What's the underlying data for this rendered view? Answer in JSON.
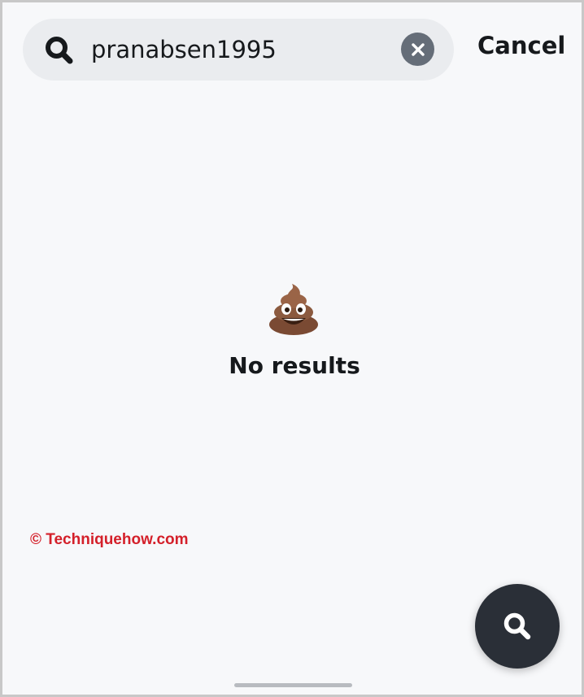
{
  "search": {
    "value": "pranabsen1995",
    "icon": "search-icon",
    "clear_icon": "close-icon",
    "cancel_label": "Cancel"
  },
  "empty_state": {
    "emoji": "poop-emoji",
    "message": "No results"
  },
  "watermark": {
    "text": "© Techniquehow.com"
  },
  "fab": {
    "icon": "search-icon"
  },
  "colors": {
    "background": "#f7f8fa",
    "search_field": "#eaecef",
    "text": "#16191c",
    "clear_button": "#656d78",
    "fab": "#2a2f37",
    "watermark": "#d4202a"
  }
}
